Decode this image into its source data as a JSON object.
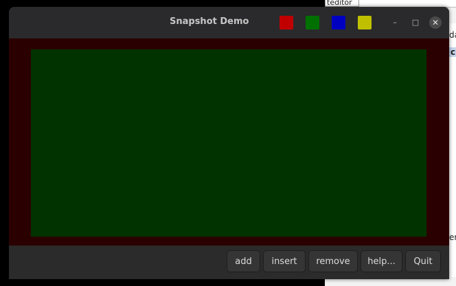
{
  "window": {
    "title": "Snapshot Demo",
    "swatches": [
      {
        "name": "red",
        "color": "#c00000"
      },
      {
        "name": "green",
        "color": "#007000"
      },
      {
        "name": "blue",
        "color": "#0000c0"
      },
      {
        "name": "yellow",
        "color": "#c0c000"
      }
    ],
    "controls": {
      "minimize": "–",
      "maximize": "□",
      "close": "✕"
    }
  },
  "canvas": {
    "outer_color": "#2a0000",
    "inner_color": "#003300"
  },
  "buttons": {
    "add": "add",
    "insert": "insert",
    "remove": "remove",
    "help": "help...",
    "quit": "Quit"
  },
  "background": {
    "tab_text": "teditor",
    "frag1": "da",
    "frag2": "c",
    "frag3": "er"
  }
}
